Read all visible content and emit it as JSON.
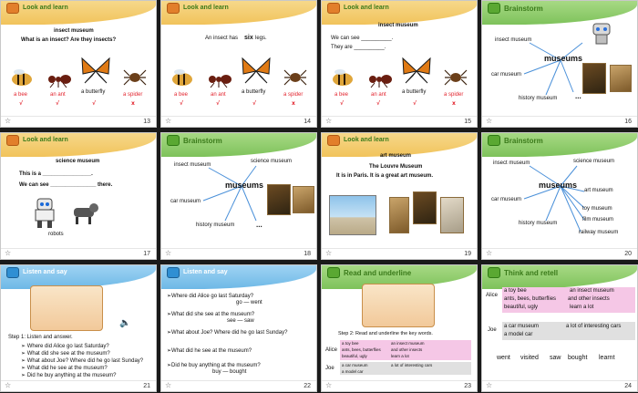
{
  "slides": [
    {
      "num": "13",
      "header": "Look and learn",
      "title": "insect museum",
      "question": "What is an insect? Are they insects?",
      "labels": [
        "a bee",
        "an ant",
        "a butterfly",
        "a spider"
      ],
      "marks": [
        "√",
        "√",
        "√",
        "x"
      ]
    },
    {
      "num": "14",
      "header": "Look and learn",
      "line_a": "An insect has",
      "line_b": "six",
      "line_c": "legs.",
      "labels": [
        "a bee",
        "an ant",
        "a butterfly",
        "a spider"
      ],
      "marks": [
        "√",
        "√",
        "√",
        "x"
      ]
    },
    {
      "num": "15",
      "header": "Look and learn",
      "title": "insect museum",
      "line1": "We can see __________.",
      "line2": "They are __________.",
      "labels": [
        "a bee",
        "an ant",
        "a butterfly",
        "a spider"
      ],
      "marks": [
        "√",
        "√",
        "√",
        "x"
      ]
    },
    {
      "num": "16",
      "header": "Brainstorm",
      "center": "museums",
      "items": [
        "insect museum",
        "car museum",
        "history museum",
        "..."
      ]
    },
    {
      "num": "17",
      "header": "Look and learn",
      "title": "science museum",
      "line1": "This is a ________________.",
      "line2": "We can see _______________ there.",
      "caption": "robots"
    },
    {
      "num": "18",
      "header": "Brainstorm",
      "center": "museums",
      "items": [
        "insect museum",
        "science museum",
        "car museum",
        "history museum",
        "..."
      ]
    },
    {
      "num": "19",
      "header": "Look and learn",
      "title": "art museum",
      "line1": "The Louvre Museum",
      "line2": "It is in Paris. It is a great art museum."
    },
    {
      "num": "20",
      "header": "Brainstorm",
      "center": "museums",
      "items": [
        "insect museum",
        "science museum",
        "art museum",
        "car museum",
        "toy museum",
        "film museum",
        "history museum",
        "railway museum"
      ]
    },
    {
      "num": "21",
      "header": "Listen and say",
      "step": "Step 1: Listen and answer.",
      "questions": [
        "Where did Alice go last Saturday?",
        "What did she see at the museum?",
        "What about Joe? Where did he go last Sunday?",
        "What did he see at the museum?",
        "Did he buy anything at the museum?"
      ]
    },
    {
      "num": "22",
      "header": "Listen and say",
      "q1": "Where did Alice go last Saturday?",
      "a1": "go — went",
      "q2": "What did she see at the museum?",
      "a2": "see — saw",
      "q3": "What about Joe? Where did he go last Sunday?",
      "q4": "What did he see at the museum?",
      "q5": "Did he buy anything at the museum?",
      "a5": "buy — bought"
    },
    {
      "num": "23",
      "header": "Read and underline",
      "step": "Step 2: Read and underline the key words.",
      "alice": "Alice",
      "joe": "Joe",
      "alice_rows": [
        [
          "a toy bee",
          "an insect museum"
        ],
        [
          "ants, bees, butterflies",
          "and other insects"
        ],
        [
          "beautiful, ugly",
          "learn a lot"
        ]
      ],
      "joe_rows": [
        [
          "a car museum",
          "a lot of interesting cars"
        ],
        [
          "a model car",
          ""
        ]
      ]
    },
    {
      "num": "24",
      "header": "Think and retell",
      "alice": "Alice",
      "joe": "Joe",
      "alice_rows": [
        [
          "a toy bee",
          "an insect museum"
        ],
        [
          "ants, bees, butterflies",
          "and other insects"
        ],
        [
          "beautiful, ugly",
          "learn a lot"
        ]
      ],
      "joe_rows": [
        [
          "a car museum",
          "a lot of interesting cars"
        ],
        [
          "a model car",
          ""
        ]
      ],
      "verbs": [
        "went",
        "visited",
        "saw",
        "bought",
        "learnt"
      ]
    }
  ],
  "colors": {
    "accent_red": "#e2232d",
    "header_green": "#3a7a1a",
    "pink": "#f5c7e6"
  },
  "icons": [
    "bee-icon",
    "ant-icon",
    "butterfly-icon",
    "spider-icon",
    "speaker-icon",
    "slide-footer-icon"
  ]
}
